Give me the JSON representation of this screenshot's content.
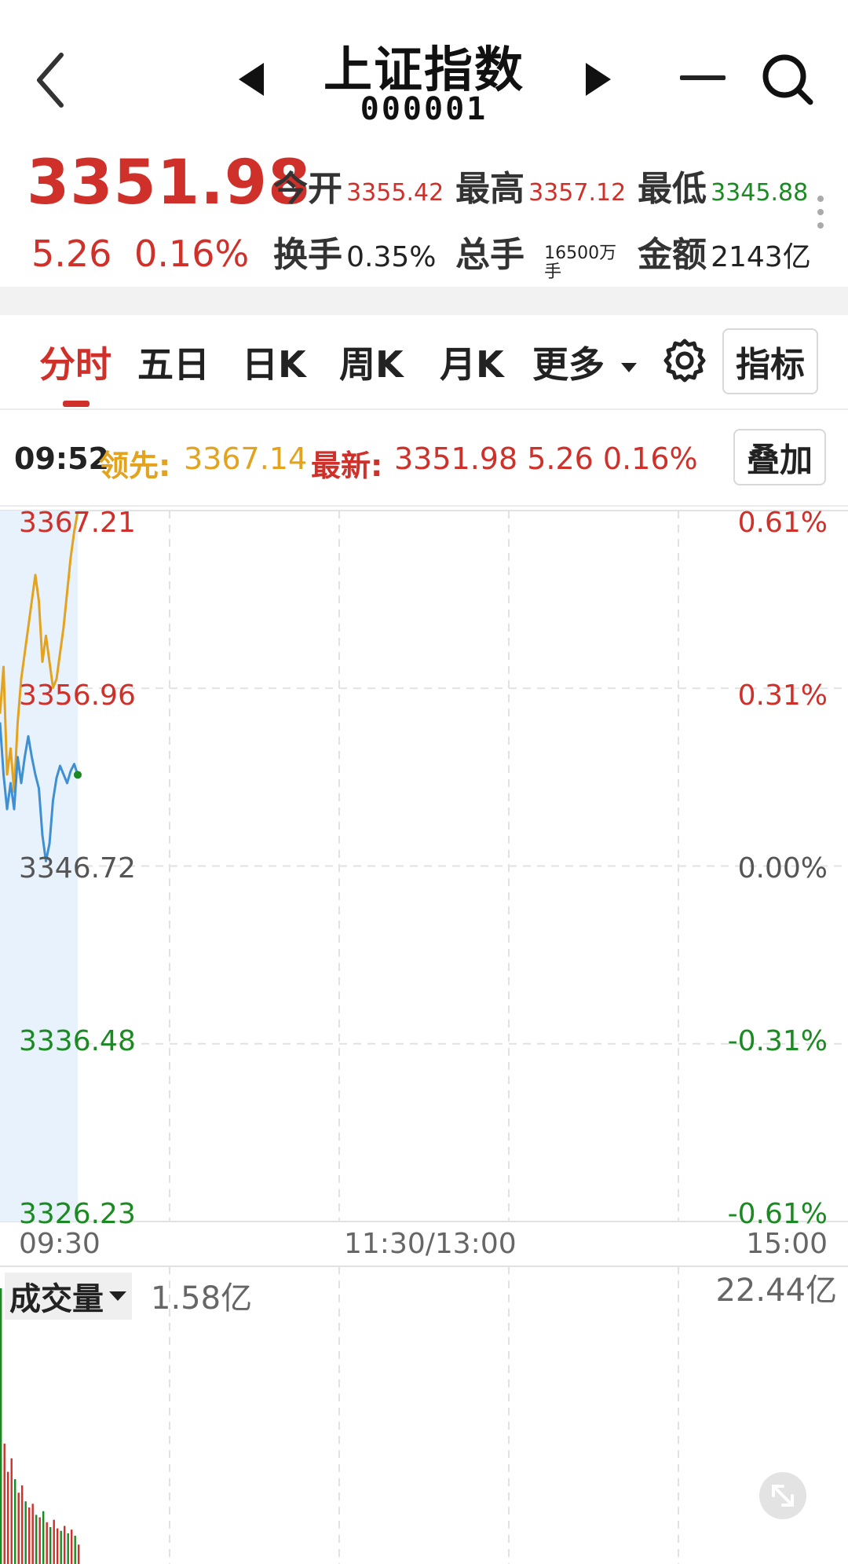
{
  "header": {
    "title": "上证指数",
    "code": "000001"
  },
  "quote": {
    "price": "3351.98",
    "change": "5.26",
    "change_pct": "0.16%",
    "open_label": "今开",
    "open": "3355.42",
    "high_label": "最高",
    "high": "3357.12",
    "low_label": "最低",
    "low": "3345.88",
    "turnover_label": "换手",
    "turnover": "0.35%",
    "total_hands_label": "总手",
    "total_hands": "16500万手",
    "amount_label": "金额",
    "amount": "2143亿"
  },
  "tabs": [
    "分时",
    "五日",
    "日K",
    "周K",
    "月K",
    "更多"
  ],
  "active_tab": "分时",
  "indicator_button": "指标",
  "info": {
    "time": "09:52",
    "lead_label": "领先:",
    "lead_value": "3367.14",
    "latest_label": "最新:",
    "latest_value": "3351.98 5.26 0.16%"
  },
  "overlay_button": "叠加",
  "chart_data": {
    "type": "line",
    "y_left_labels": [
      "3367.21",
      "3356.96",
      "3346.72",
      "3336.48",
      "3326.23"
    ],
    "y_right_labels": [
      "0.61%",
      "0.31%",
      "0.00%",
      "-0.31%",
      "-0.61%"
    ],
    "ylim": [
      3326.23,
      3367.21
    ],
    "x_labels": [
      "09:30",
      "11:30/13:00",
      "15:00"
    ],
    "grid": true,
    "series": [
      {
        "name": "领先",
        "color": "#e3a31e",
        "x": [
          "09:30",
          "09:31",
          "09:32",
          "09:33",
          "09:34",
          "09:35",
          "09:36",
          "09:37",
          "09:38",
          "09:39",
          "09:40",
          "09:41",
          "09:42",
          "09:43",
          "09:44",
          "09:45",
          "09:46",
          "09:47",
          "09:48",
          "09:49",
          "09:50",
          "09:51",
          "09:52"
        ],
        "values": [
          3355.5,
          3358.2,
          3352.0,
          3353.5,
          3351.0,
          3355.0,
          3357.5,
          3359.0,
          3360.5,
          3362.0,
          3363.5,
          3362.0,
          3358.5,
          3360.0,
          3358.5,
          3357.0,
          3357.5,
          3359.0,
          3360.5,
          3362.5,
          3364.5,
          3366.0,
          3367.14
        ]
      },
      {
        "name": "最新",
        "color": "#3f8fd2",
        "x": [
          "09:30",
          "09:31",
          "09:32",
          "09:33",
          "09:34",
          "09:35",
          "09:36",
          "09:37",
          "09:38",
          "09:39",
          "09:40",
          "09:41",
          "09:42",
          "09:43",
          "09:44",
          "09:45",
          "09:46",
          "09:47",
          "09:48",
          "09:49",
          "09:50",
          "09:51",
          "09:52"
        ],
        "values": [
          3355.0,
          3352.0,
          3350.0,
          3351.5,
          3350.0,
          3353.0,
          3351.5,
          3353.0,
          3354.2,
          3353.0,
          3352.0,
          3351.2,
          3348.5,
          3347.0,
          3348.0,
          3350.5,
          3351.8,
          3352.5,
          3352.0,
          3351.5,
          3352.2,
          3352.6,
          3351.98
        ]
      }
    ],
    "volume": {
      "label": "成交量",
      "current": "1.58亿",
      "max_label": "22.44亿",
      "max": 22.44,
      "values": [
        22.44,
        9.8,
        7.5,
        8.6,
        6.9,
        5.8,
        6.4,
        5.1,
        4.6,
        4.9,
        4.0,
        3.8,
        4.3,
        3.4,
        3.0,
        3.6,
        2.9,
        2.7,
        3.1,
        2.5,
        2.8,
        2.3,
        1.58
      ],
      "colors": [
        "green",
        "red",
        "red",
        "red",
        "green",
        "red",
        "red",
        "green",
        "red",
        "red",
        "green",
        "red",
        "green",
        "red",
        "green",
        "red",
        "red",
        "green",
        "red",
        "green",
        "red",
        "green",
        "red"
      ]
    }
  }
}
